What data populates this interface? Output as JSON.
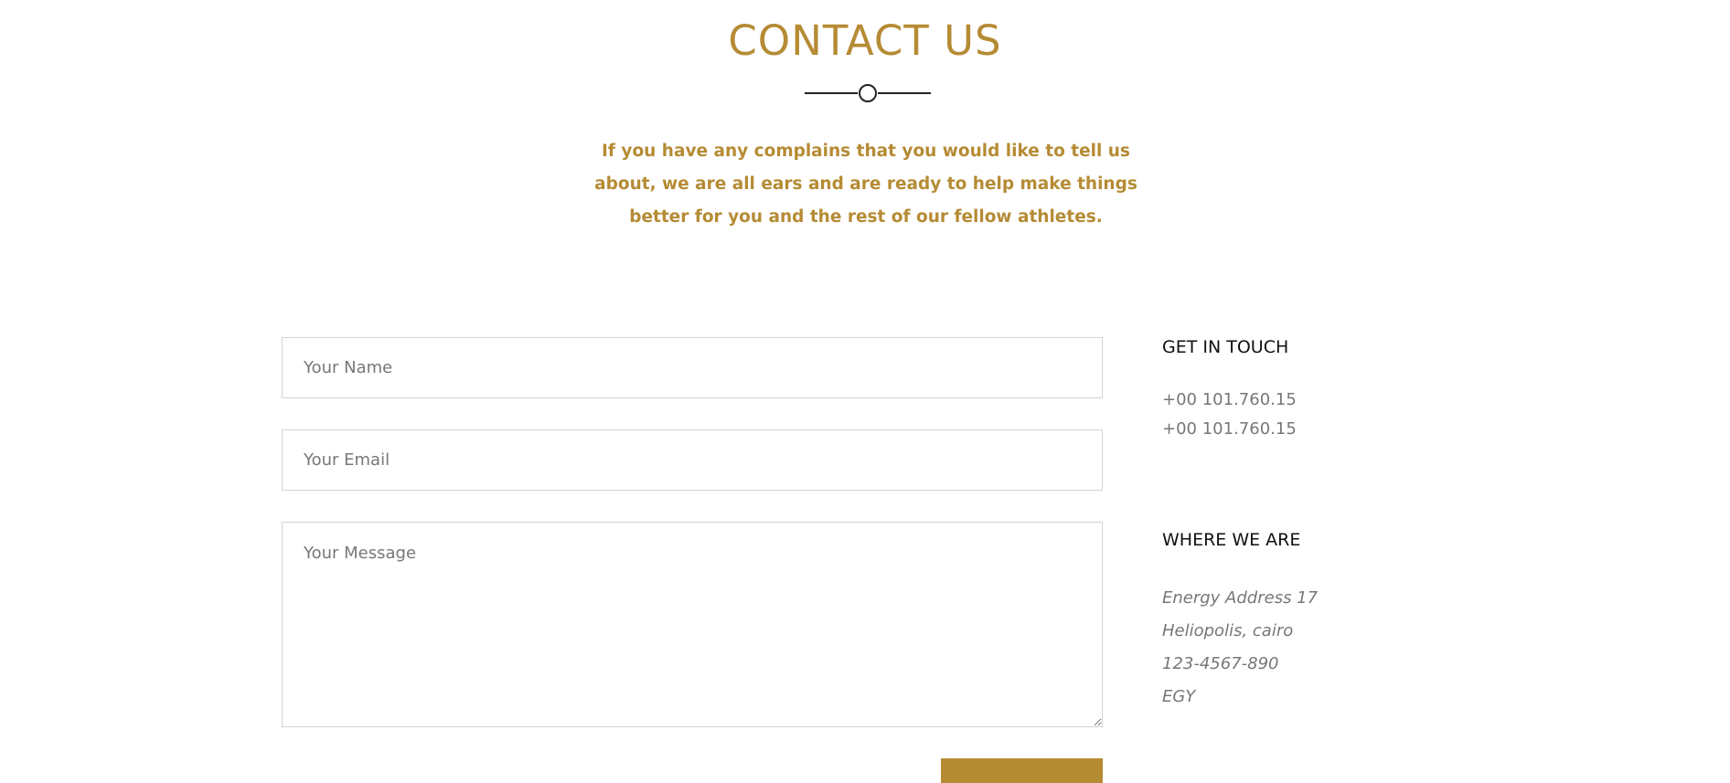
{
  "colors": {
    "accent": "#b58b34",
    "muted_text": "#777777",
    "heading_text": "#111111",
    "border": "#d4d4d4"
  },
  "header": {
    "title": "CONTACT US",
    "intro": "If you have any complains that you would like to tell us about, we are all ears and are ready to help make things better for you and the rest of our fellow athletes."
  },
  "form": {
    "name_placeholder": "Your Name",
    "email_placeholder": "Your Email",
    "message_placeholder": "Your Message",
    "name_value": "",
    "email_value": "",
    "message_value": ""
  },
  "sidebar": {
    "get_in_touch": {
      "heading": "GET IN TOUCH",
      "phones": [
        "+00 101.760.15",
        "+00 101.760.15"
      ]
    },
    "where_we_are": {
      "heading": "WHERE WE ARE",
      "lines": [
        "Energy Address 17",
        "Heliopolis, cairo",
        "123-4567-890",
        "EGY"
      ]
    }
  }
}
